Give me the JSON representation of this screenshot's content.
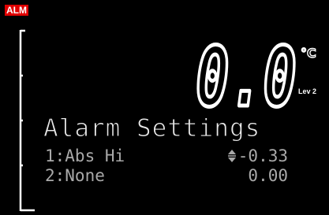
{
  "header": {
    "alarm_badge": "ALM"
  },
  "display": {
    "process_value": "0.0",
    "unit": "°C",
    "level": "Lev 2"
  },
  "menu": {
    "title": "Alarm Settings",
    "rows": [
      {
        "label": "1:Abs Hi",
        "value": "-0.33",
        "adjust_icon": "up-down-arrows-icon"
      },
      {
        "label": "2:None",
        "value": "0.00"
      }
    ]
  },
  "colors": {
    "alarm_badge_bg": "#e00000",
    "primary_text": "#ffffff",
    "secondary_text": "#a9a9a9",
    "background": "#000000"
  }
}
